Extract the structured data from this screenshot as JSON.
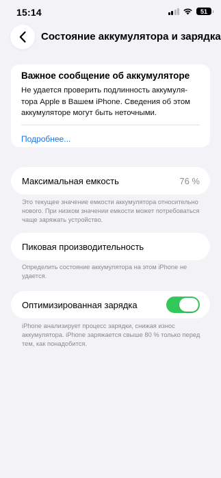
{
  "status_bar": {
    "time": "15:14",
    "battery_level": "51",
    "icons": [
      "cellular-signal-icon",
      "wifi-icon",
      "battery-icon"
    ]
  },
  "header": {
    "title": "Состояние аккумулятора и зарядка",
    "back_icon": "chevron-left-icon"
  },
  "notice": {
    "title": "Важное сообщение об аккумуляторе",
    "text": "Не удается проверить подлинность аккумуля-тора Apple в Вашем iPhone. Сведения об этом аккумуляторе могут быть неточными.",
    "link": "Подробнее..."
  },
  "capacity": {
    "label": "Максимальная емкость",
    "value": "76 %",
    "note": "Это текущее значение емкости аккумулятора относительно нового. При низком значении емкости может потребоваться чаще заряжать устройство."
  },
  "peak": {
    "label": "Пиковая производительность",
    "note": "Определить состояние аккумулятора на этом iPhone не удается."
  },
  "charging": {
    "label": "Оптимизированная зарядка",
    "enabled": true,
    "toggle_color": "#34c759",
    "note": "iPhone анализирует процесс зарядки, снижая износ аккумулятора. iPhone заряжается свыше 80 % только перед тем, как понадобится."
  },
  "colors": {
    "background": "#f2f2f7",
    "link": "#1a73e8",
    "secondary_text": "#8e8e93"
  }
}
